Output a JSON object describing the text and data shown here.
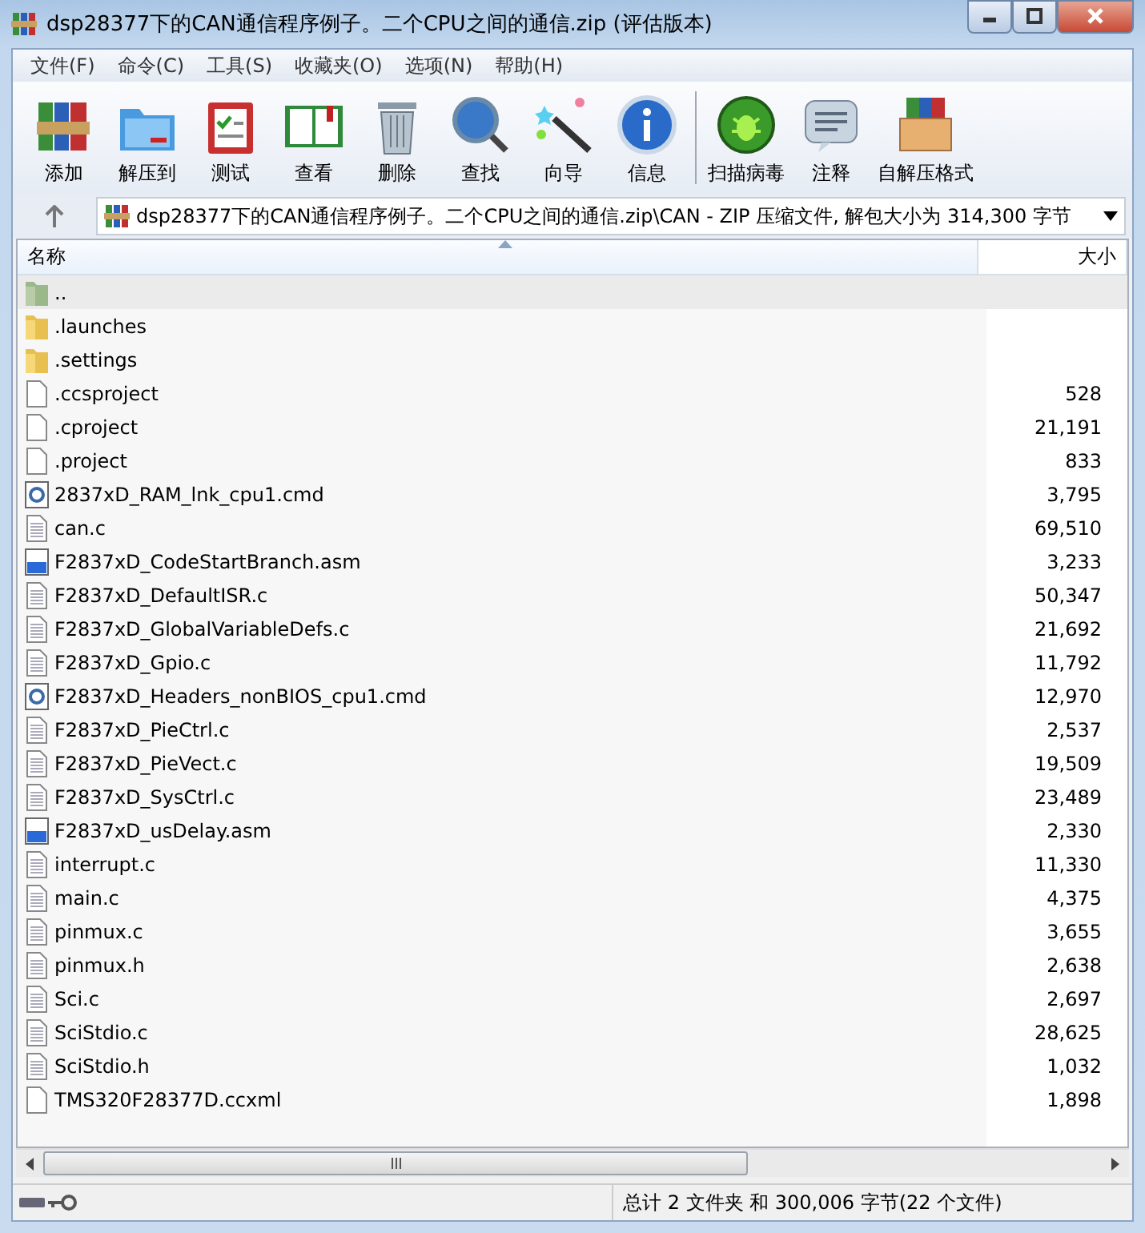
{
  "window": {
    "title": "dsp28377下的CAN通信程序例子。二个CPU之间的通信.zip (评估版本)"
  },
  "menu": [
    "文件(F)",
    "命令(C)",
    "工具(S)",
    "收藏夹(O)",
    "选项(N)",
    "帮助(H)"
  ],
  "toolbar": [
    {
      "kind": "add",
      "label": "添加"
    },
    {
      "kind": "extract",
      "label": "解压到"
    },
    {
      "kind": "test",
      "label": "测试"
    },
    {
      "kind": "view",
      "label": "查看"
    },
    {
      "kind": "delete",
      "label": "删除"
    },
    {
      "kind": "find",
      "label": "查找"
    },
    {
      "kind": "wizard",
      "label": "向导"
    },
    {
      "kind": "info",
      "label": "信息"
    },
    {
      "kind": "scan",
      "label": "扫描病毒"
    },
    {
      "kind": "comment",
      "label": "注释"
    },
    {
      "kind": "sfx",
      "label": "自解压格式"
    }
  ],
  "address": {
    "path": "dsp28377下的CAN通信程序例子。二个CPU之间的通信.zip\\CAN - ZIP 压缩文件, 解包大小为 314,300 字节"
  },
  "columns": [
    {
      "label": "名称",
      "sorted": true
    },
    {
      "label": "大小",
      "sorted": false
    }
  ],
  "rows": [
    {
      "kind": "parent",
      "name": "..",
      "selected": true
    },
    {
      "kind": "folder",
      "name": ".launches",
      "selected": false
    },
    {
      "kind": "folder",
      "name": ".settings",
      "selected": false
    },
    {
      "kind": "file",
      "name": ".ccsproject",
      "size": "528",
      "selected": false
    },
    {
      "kind": "file",
      "name": ".cproject",
      "size": "21,191",
      "selected": false
    },
    {
      "kind": "file",
      "name": ".project",
      "size": "833",
      "selected": false
    },
    {
      "kind": "cmd",
      "name": "2837xD_RAM_lnk_cpu1.cmd",
      "size": "3,795",
      "selected": false
    },
    {
      "kind": "text",
      "name": "can.c",
      "size": "69,510",
      "selected": false
    },
    {
      "kind": "asm",
      "name": "F2837xD_CodeStartBranch.asm",
      "size": "3,233",
      "selected": false
    },
    {
      "kind": "text",
      "name": "F2837xD_DefaultISR.c",
      "size": "50,347",
      "selected": false
    },
    {
      "kind": "text",
      "name": "F2837xD_GlobalVariableDefs.c",
      "size": "21,692",
      "selected": false
    },
    {
      "kind": "text",
      "name": "F2837xD_Gpio.c",
      "size": "11,792",
      "selected": false
    },
    {
      "kind": "cmd",
      "name": "F2837xD_Headers_nonBIOS_cpu1.cmd",
      "size": "12,970",
      "selected": false
    },
    {
      "kind": "text",
      "name": "F2837xD_PieCtrl.c",
      "size": "2,537",
      "selected": false
    },
    {
      "kind": "text",
      "name": "F2837xD_PieVect.c",
      "size": "19,509",
      "selected": false
    },
    {
      "kind": "text",
      "name": "F2837xD_SysCtrl.c",
      "size": "23,489",
      "selected": false
    },
    {
      "kind": "asm",
      "name": "F2837xD_usDelay.asm",
      "size": "2,330",
      "selected": false
    },
    {
      "kind": "text",
      "name": "interrupt.c",
      "size": "11,330",
      "selected": false
    },
    {
      "kind": "text",
      "name": "main.c",
      "size": "4,375",
      "selected": false
    },
    {
      "kind": "text",
      "name": "pinmux.c",
      "size": "3,655",
      "selected": false
    },
    {
      "kind": "text",
      "name": "pinmux.h",
      "size": "2,638",
      "selected": false
    },
    {
      "kind": "text",
      "name": "Sci.c",
      "size": "2,697",
      "selected": false
    },
    {
      "kind": "text",
      "name": "SciStdio.c",
      "size": "28,625",
      "selected": false
    },
    {
      "kind": "text",
      "name": "SciStdio.h",
      "size": "1,032",
      "selected": false
    },
    {
      "kind": "file",
      "name": "TMS320F28377D.ccxml",
      "size": "1,898",
      "selected": false
    }
  ],
  "status_bar": {
    "summary": "总计 2 文件夹 和 300,006 字节(22 个文件)"
  }
}
